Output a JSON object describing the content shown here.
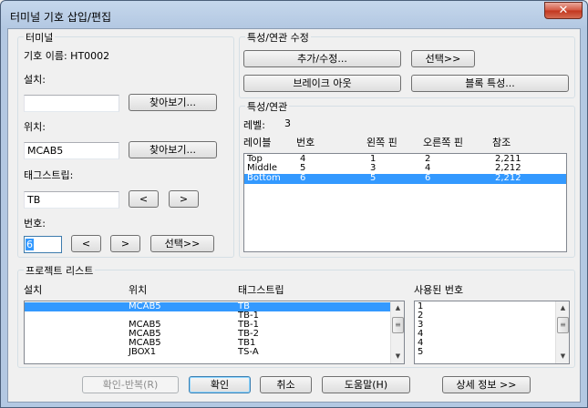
{
  "window": {
    "title": "터미널 기호 삽입/편집",
    "close_glyph": "✕"
  },
  "terminal": {
    "group_label": "터미널",
    "symbol_name": "기호 이름: HT0002",
    "install_label": "설치:",
    "install_value": "",
    "browse1": "찾아보기...",
    "location_label": "위치:",
    "location_value": "MCAB5",
    "browse2": "찾아보기...",
    "tagstrip_label": "태그스트립:",
    "tagstrip_value": "TB",
    "prev": "<",
    "next": ">",
    "number_label": "번호:",
    "number_value": "6",
    "select": "선택>>"
  },
  "props_edit": {
    "group_label": "특성/연관 수정",
    "add_edit": "추가/수정...",
    "select": "선택>>",
    "break": "브레이크 아웃",
    "block_props": "블록 특성..."
  },
  "props": {
    "group_label": "특성/연관",
    "level_label": "레벨:",
    "level_value": "3",
    "headers": [
      "레이블",
      "번호",
      "왼쪽 핀",
      "오른쪽 핀",
      "참조"
    ],
    "rows": [
      [
        "Top",
        "4",
        "1",
        "2",
        "2,211"
      ],
      [
        "Middle",
        "5",
        "3",
        "4",
        "2,212"
      ],
      [
        "Bottom",
        "6",
        "5",
        "6",
        "2,212"
      ]
    ]
  },
  "project": {
    "group_label": "프로젝트 리스트",
    "headers": [
      "설치",
      "위치",
      "태그스트립"
    ],
    "used_header": "사용된 번호",
    "rows": [
      [
        "",
        "MCAB5",
        "TB"
      ],
      [
        "",
        "",
        "TB-1"
      ],
      [
        "",
        "MCAB5",
        "TB-1"
      ],
      [
        "",
        "MCAB5",
        "TB-2"
      ],
      [
        "",
        "MCAB5",
        "TB1"
      ],
      [
        "",
        "JBOX1",
        "TS-A"
      ]
    ],
    "used_numbers": [
      "1",
      "2",
      "3",
      "4",
      "4",
      "5"
    ]
  },
  "footer": {
    "ok_repeat": "확인-반복(R)",
    "ok": "확인",
    "cancel": "취소",
    "help": "도움말(H)",
    "details": "상세 정보 >>"
  }
}
